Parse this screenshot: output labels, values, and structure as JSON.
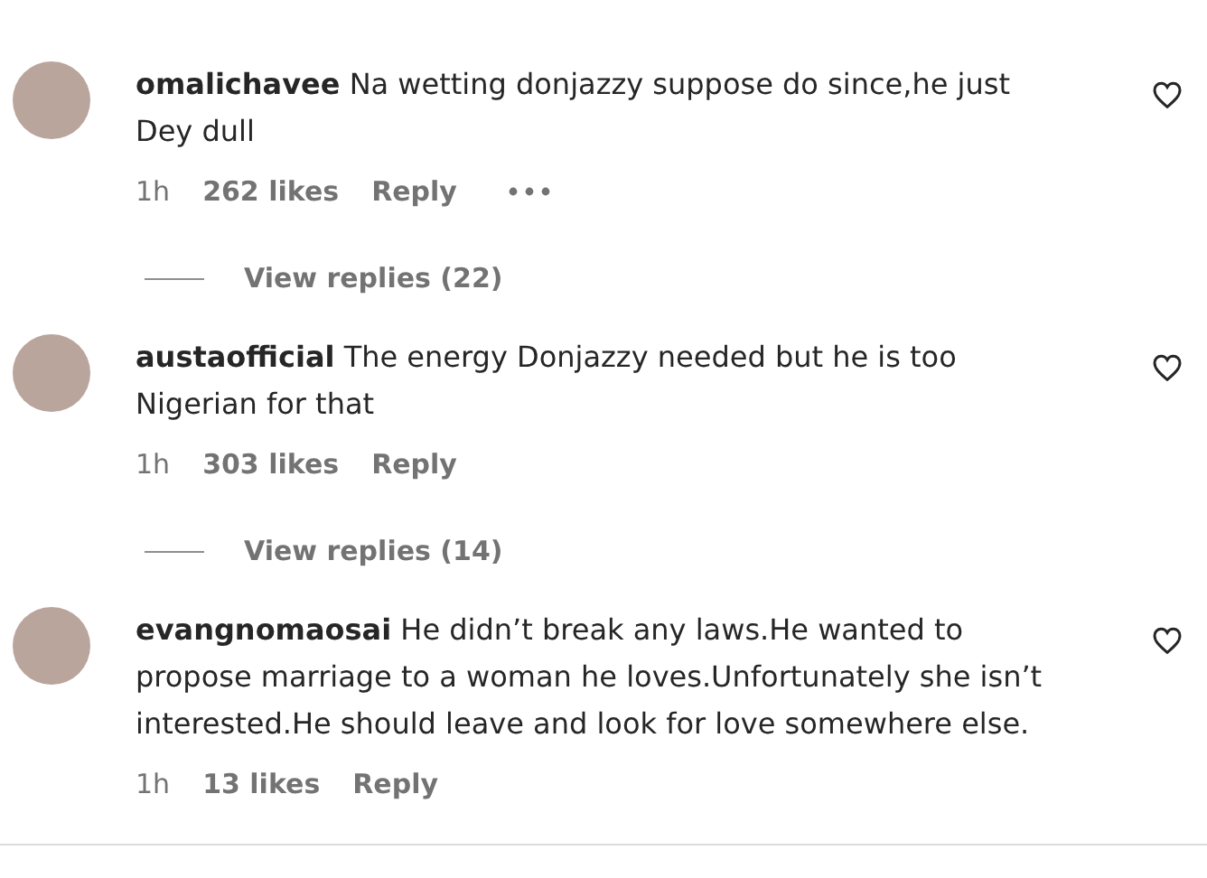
{
  "comments": [
    {
      "username": "omalichavee",
      "text": "Na wetting donjazzy suppose do since,he just Dey dull",
      "time": "1h",
      "likes": "262 likes",
      "reply": "Reply",
      "more_options": true,
      "liked": false,
      "view_replies": "View replies (22)"
    },
    {
      "username": "austaofficial",
      "text": "The energy Donjazzy needed but he is too Nigerian for that",
      "time": "1h",
      "likes": "303 likes",
      "reply": "Reply",
      "more_options": false,
      "liked": false,
      "view_replies": "View replies (14)"
    },
    {
      "username": "evangnomaosai",
      "text": "He didn’t break any laws.He wanted to propose marriage to a woman he loves.Unfortunately she isn’t interested.He should leave and look for love somewhere else.",
      "time": "1h",
      "likes": "13 likes",
      "reply": "Reply",
      "more_options": false,
      "liked": false
    }
  ]
}
